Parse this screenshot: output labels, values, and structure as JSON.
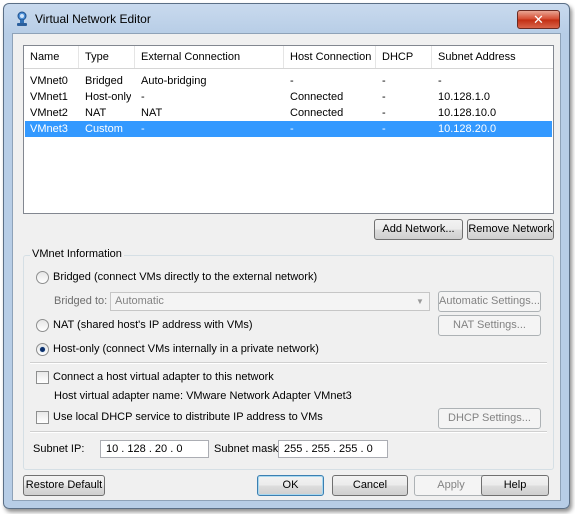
{
  "window": {
    "title": "Virtual Network Editor",
    "close_glyph": "✕",
    "app_icon": "network-user-icon"
  },
  "networks": {
    "columns": [
      "Name",
      "Type",
      "External Connection",
      "Host Connection",
      "DHCP",
      "Subnet Address"
    ],
    "rows": [
      {
        "name": "VMnet0",
        "type": "Bridged",
        "external": "Auto-bridging",
        "host": "-",
        "dhcp": "-",
        "subnet": "-"
      },
      {
        "name": "VMnet1",
        "type": "Host-only",
        "external": "-",
        "host": "Connected",
        "dhcp": "-",
        "subnet": "10.128.1.0"
      },
      {
        "name": "VMnet2",
        "type": "NAT",
        "external": "NAT",
        "host": "Connected",
        "dhcp": "-",
        "subnet": "10.128.10.0"
      },
      {
        "name": "VMnet3",
        "type": "Custom",
        "external": "-",
        "host": "-",
        "dhcp": "-",
        "subnet": "10.128.20.0"
      }
    ],
    "selected_index": 3
  },
  "list_buttons": {
    "add_network": "Add Network...",
    "remove_network": "Remove Network"
  },
  "vmnet_info": {
    "group_label": "VMnet Information",
    "bridged_label": "Bridged (connect VMs directly to the external network)",
    "bridged_to_label": "Bridged to:",
    "bridged_to_value": "Automatic",
    "automatic_settings": "Automatic Settings...",
    "nat_label": "NAT (shared host's IP address with VMs)",
    "nat_settings": "NAT Settings...",
    "hostonly_label": "Host-only (connect VMs internally in a private network)",
    "selected_mode": "host-only",
    "connect_adapter_label": "Connect a host virtual adapter to this network",
    "adapter_name_label": "Host virtual adapter name: VMware Network Adapter VMnet3",
    "dhcp_label": "Use local DHCP service to distribute IP address to VMs",
    "dhcp_settings": "DHCP Settings...",
    "subnet_ip_label": "Subnet IP:",
    "subnet_ip_value": "10 . 128 . 20 . 0",
    "subnet_mask_label": "Subnet mask:",
    "subnet_mask_value": "255 . 255 . 255 . 0"
  },
  "footer": {
    "restore_default": "Restore Default",
    "ok": "OK",
    "cancel": "Cancel",
    "apply": "Apply",
    "help": "Help"
  },
  "colors": {
    "selection": "#3399ff",
    "title_gradient_top": "#c9daee",
    "close_button": "#c42e13"
  }
}
